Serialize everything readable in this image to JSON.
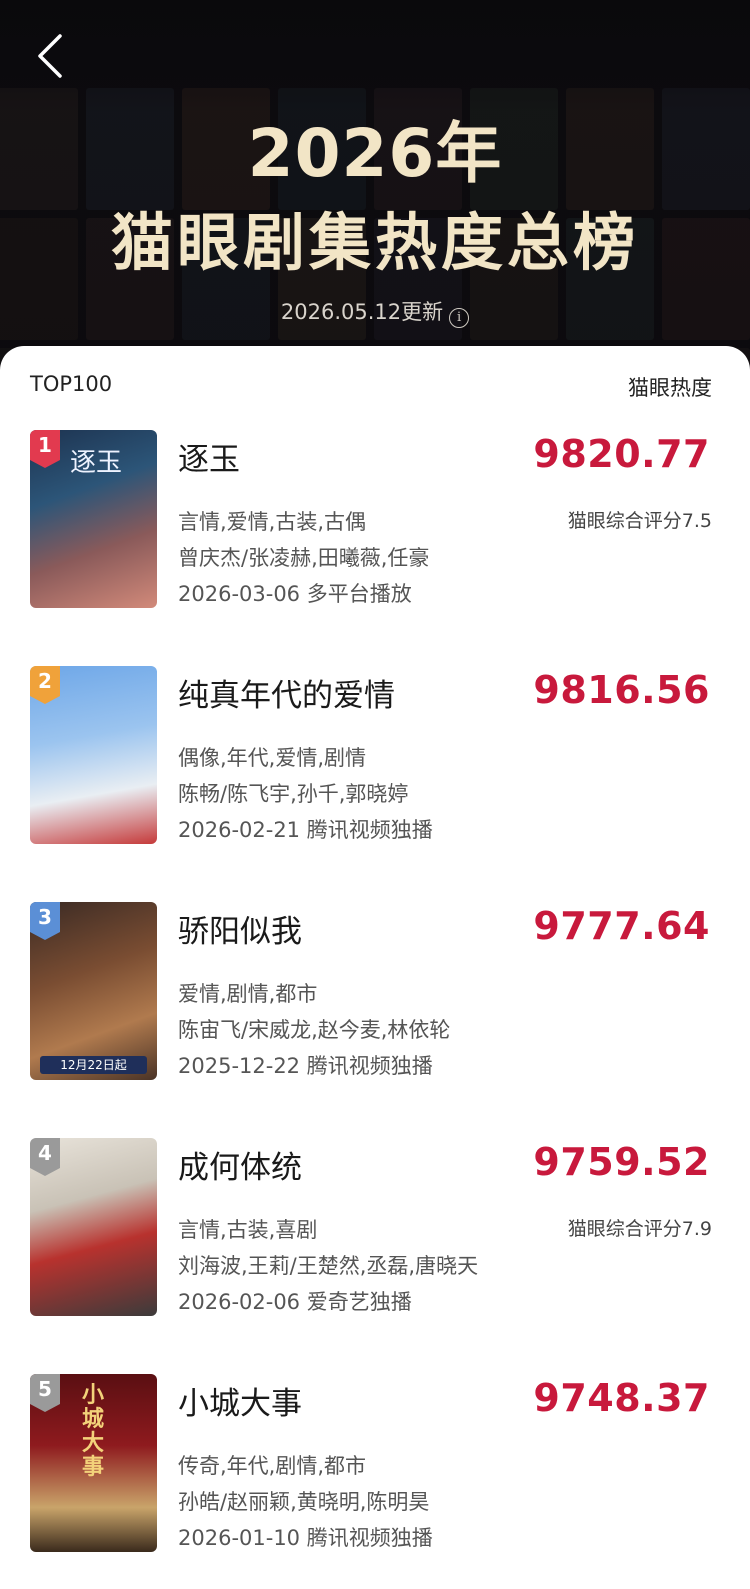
{
  "header": {
    "title_line1": "2026年",
    "title_line2": "猫眼剧集热度总榜",
    "update_text": "2026.05.12更新",
    "back_icon": "chevron-left-icon",
    "info_icon": "info-icon"
  },
  "list_header": {
    "left": "TOP100",
    "right": "猫眼热度"
  },
  "colors": {
    "score": "#c8193c",
    "title_gold": "#f2e5c6",
    "rank1": "#e23a4f",
    "rank2": "#f0a23a",
    "rank3": "#5b8fd6",
    "rank_other": "#9a9a9a"
  },
  "items": [
    {
      "rank": "1",
      "name": "逐玉",
      "score": "9820.77",
      "genres": "言情,爱情,古装,古偶",
      "rating": "猫眼综合评分7.5",
      "cast": "曾庆杰/张凌赫,田曦薇,任豪",
      "release": "2026-03-06 多平台播放",
      "poster_text": "逐玉"
    },
    {
      "rank": "2",
      "name": "纯真年代的爱情",
      "score": "9816.56",
      "genres": "偶像,年代,爱情,剧情",
      "rating": "",
      "cast": "陈畅/陈飞宇,孙千,郭晓婷",
      "release": "2026-02-21 腾讯视频独播",
      "poster_text": ""
    },
    {
      "rank": "3",
      "name": "骄阳似我",
      "score": "9777.64",
      "genres": "爱情,剧情,都市",
      "rating": "",
      "cast": "陈宙飞/宋威龙,赵今麦,林依轮",
      "release": "2025-12-22 腾讯视频独播",
      "poster_text": "12月22日起"
    },
    {
      "rank": "4",
      "name": "成何体统",
      "score": "9759.52",
      "genres": "言情,古装,喜剧",
      "rating": "猫眼综合评分7.9",
      "cast": "刘海波,王莉/王楚然,丞磊,唐晓天",
      "release": "2026-02-06 爱奇艺独播",
      "poster_text": ""
    },
    {
      "rank": "5",
      "name": "小城大事",
      "score": "9748.37",
      "genres": "传奇,年代,剧情,都市",
      "rating": "",
      "cast": "孙皓/赵丽颖,黄晓明,陈明昊",
      "release": "2026-01-10 腾讯视频独播",
      "poster_text": "小城大事"
    }
  ]
}
